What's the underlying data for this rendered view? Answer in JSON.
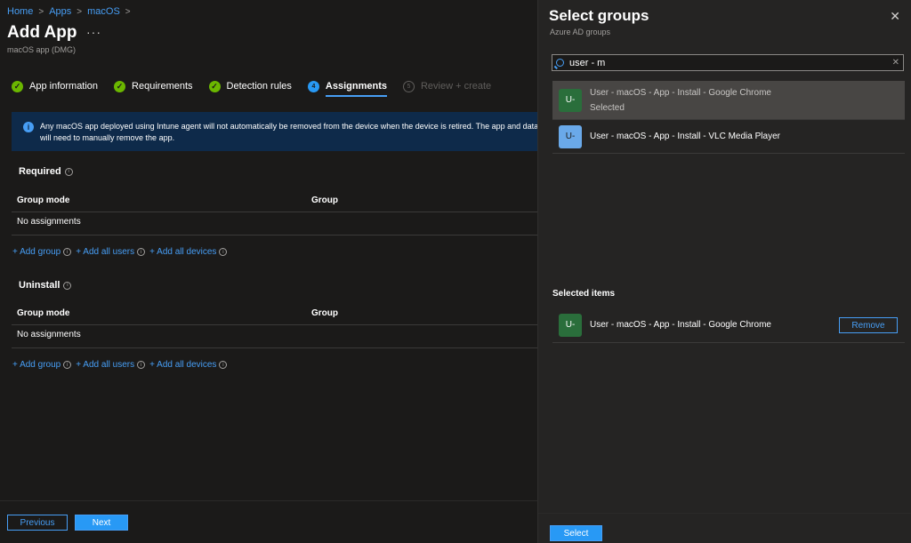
{
  "breadcrumb": [
    "Home",
    "Apps",
    "macOS"
  ],
  "page": {
    "title": "Add App",
    "more": "···",
    "subtitle": "macOS app (DMG)"
  },
  "steps": [
    {
      "label": "App information",
      "state": "complete"
    },
    {
      "label": "Requirements",
      "state": "complete"
    },
    {
      "label": "Detection rules",
      "state": "complete"
    },
    {
      "label": "Assignments",
      "state": "active",
      "number": "4"
    },
    {
      "label": "Review + create",
      "state": "disabled",
      "number": "5"
    }
  ],
  "info_banner": {
    "line1": "Any macOS app deployed using Intune agent will not automatically be removed from the device when the device is retired. The app and data i",
    "line2": "will need to manually remove the app."
  },
  "required": {
    "title": "Required",
    "col_group_mode": "Group mode",
    "col_group": "Group",
    "empty": "No assignments",
    "add_group": "+ Add group",
    "add_all_users": "+ Add all users",
    "add_all_devices": "+ Add all devices"
  },
  "uninstall": {
    "title": "Uninstall",
    "col_group_mode": "Group mode",
    "col_group": "Group",
    "empty": "No assignments",
    "add_group": "+ Add group",
    "add_all_users": "+ Add all users",
    "add_all_devices": "+ Add all devices"
  },
  "footer": {
    "previous": "Previous",
    "next": "Next"
  },
  "panel": {
    "title": "Select groups",
    "subtitle": "Azure AD groups",
    "close": "✕",
    "search_value": "user - m",
    "results": [
      {
        "initials": "U-",
        "name": "User - macOS - App - Install - Google Chrome",
        "status": "Selected",
        "color": "#2a6e3b"
      },
      {
        "initials": "U-",
        "name": "User - macOS - App - Install - VLC Media Player",
        "status": "",
        "color": "#6aa9e9"
      }
    ],
    "selected_title": "Selected items",
    "selected_items": [
      {
        "initials": "U-",
        "name": "User - macOS - App - Install - Google Chrome",
        "remove": "Remove"
      }
    ],
    "select_button": "Select"
  },
  "colors": {
    "accent": "#2899f5",
    "link": "#479ef5",
    "success": "#6bb700",
    "background": "#1b1a19",
    "panel": "#252423"
  }
}
